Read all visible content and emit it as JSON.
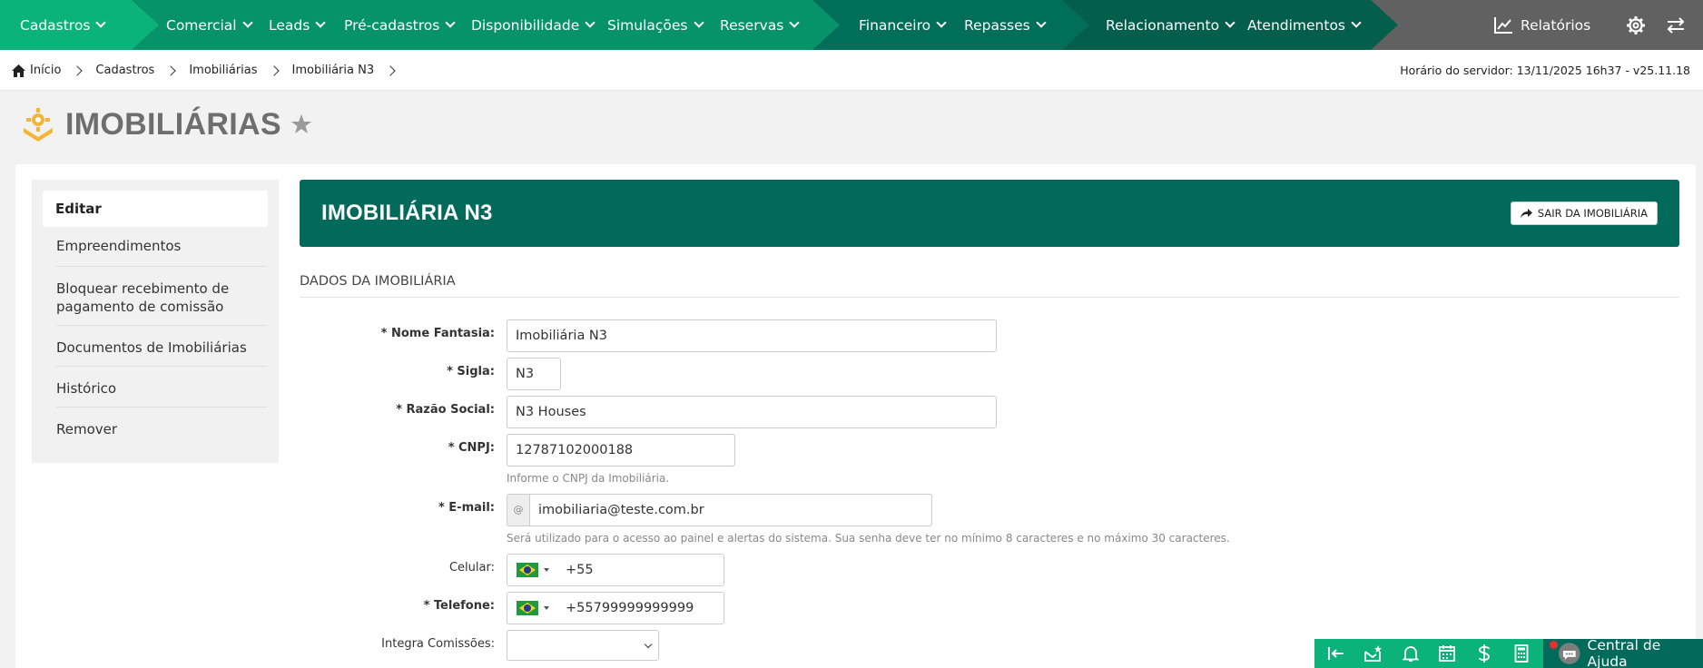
{
  "nav": {
    "items": [
      "Cadastros",
      "Comercial",
      "Leads",
      "Pré-cadastros",
      "Disponibilidade",
      "Simulações",
      "Reservas",
      "Financeiro",
      "Repasses",
      "Relacionamento",
      "Atendimentos"
    ],
    "reports_label": "Relatórios",
    "icons": [
      "chart-line-icon",
      "gear-icon",
      "swap-arrows-icon"
    ]
  },
  "breadcrumb": [
    "Início",
    "Cadastros",
    "Imobiliárias",
    "Imobiliária N3"
  ],
  "server_time": "Horário do servidor: 13/11/2025 16h37 - v25.11.18",
  "page_title": "IMOBILIÁRIAS",
  "sidebar": {
    "active": "Editar",
    "items": [
      "Empreendimentos",
      "Bloquear recebimento de pagamento de comissão",
      "Documentos de Imobiliárias",
      "Histórico",
      "Remover"
    ]
  },
  "header": {
    "title": "IMOBILIÁRIA N3",
    "exit_label": "SAIR DA IMOBILIÁRIA"
  },
  "section_title": "DADOS DA IMOBILIÁRIA",
  "form": {
    "nome_fantasia": {
      "label": "* Nome Fantasia:",
      "value": "Imobiliária N3"
    },
    "sigla": {
      "label": "* Sigla:",
      "value": "N3"
    },
    "razao_social": {
      "label": "* Razão Social:",
      "value": "N3 Houses"
    },
    "cnpj": {
      "label": "* CNPJ:",
      "value": "12787102000188",
      "help": "Informe o CNPJ da Imobiliária."
    },
    "email": {
      "label": "* E-mail:",
      "addon": "@",
      "value": "imobiliaria@teste.com.br",
      "help": "Será utilizado para o acesso ao painel e alertas do sistema. Sua senha deve ter no mínimo 8 caracteres e no máximo 30 caracteres."
    },
    "celular": {
      "label": "Celular:",
      "value": "+55"
    },
    "telefone": {
      "label": "* Telefone:",
      "value": "+55799999999999"
    },
    "integra_comissoes": {
      "label": "Integra Comissões:",
      "value": ""
    }
  },
  "help_center": "Central de Ajuda",
  "colors": {
    "nav_green": "#0bb37b",
    "nav_green_2": "#069369",
    "nav_dark": "#016e5a",
    "header_band": "#026a5a",
    "nav_gray": "#616161"
  }
}
